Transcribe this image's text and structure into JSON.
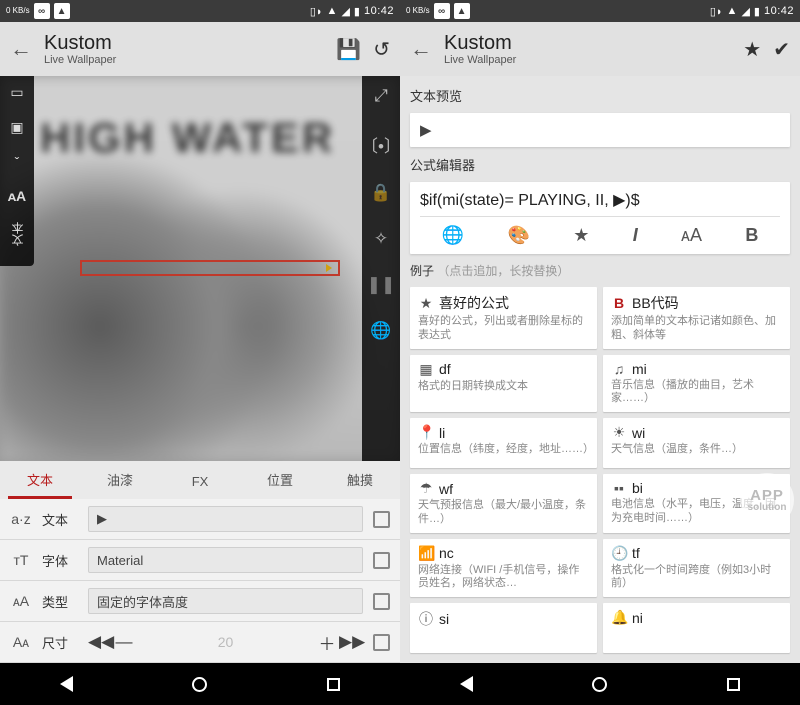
{
  "status": {
    "kb": "0\nKB/s",
    "time": "10:42"
  },
  "app": {
    "title": "Kustom",
    "subtitle": "Live Wallpaper"
  },
  "phone1": {
    "tabs": [
      "文本",
      "油漆",
      "FX",
      "位置",
      "触摸"
    ],
    "rows": {
      "text": {
        "icon": "a·z",
        "label": "文本",
        "value": "▶"
      },
      "font": {
        "icon": "тT",
        "label": "字体",
        "value": "Material"
      },
      "type": {
        "icon": "ᴀA",
        "label": "类型",
        "value": "固定的字体高度"
      },
      "size": {
        "icon": "Aᴀ",
        "label": "尺寸",
        "value": "20"
      }
    }
  },
  "phone2": {
    "preview_label": "文本预览",
    "preview_value": "▶",
    "formula_label": "公式编辑器",
    "formula_text": "$if(mi(state)= PLAYING, II, ▶)$",
    "example_label": "例子",
    "example_hint": "（点击追加，长按替换）",
    "cards": [
      {
        "icon": "★",
        "title": "喜好的公式",
        "desc": "喜好的公式，列出或者删除星标的表达式"
      },
      {
        "icon": "B",
        "title": "BB代码",
        "desc": "添加简单的文本标记诸如颜色、加粗、斜体等"
      },
      {
        "icon": "▦",
        "title": "df",
        "desc": "格式的日期转换成文本"
      },
      {
        "icon": "♫",
        "title": "mi",
        "desc": "音乐信息（播放的曲目，艺术家……）"
      },
      {
        "icon": "📍",
        "title": "li",
        "desc": "位置信息（纬度，经度，地址……）"
      },
      {
        "icon": "☀",
        "title": "wi",
        "desc": "天气信息（温度，条件…）"
      },
      {
        "icon": "☂",
        "title": "wf",
        "desc": "天气预报信息（最大/最小温度，条件…）"
      },
      {
        "icon": "▪▪",
        "title": "bi",
        "desc": "电池信息（水平，电压，温度，因为充电时间……）"
      },
      {
        "icon": "📶",
        "title": "nc",
        "desc": "网络连接（WIFI /手机信号，操作员姓名，网络状态…"
      },
      {
        "icon": "🕘",
        "title": "tf",
        "desc": "格式化一个时间跨度（例如3小时前）"
      },
      {
        "icon": "ⓘ",
        "title": "si",
        "desc": ""
      },
      {
        "icon": "🔔",
        "title": "ni",
        "desc": ""
      }
    ]
  }
}
